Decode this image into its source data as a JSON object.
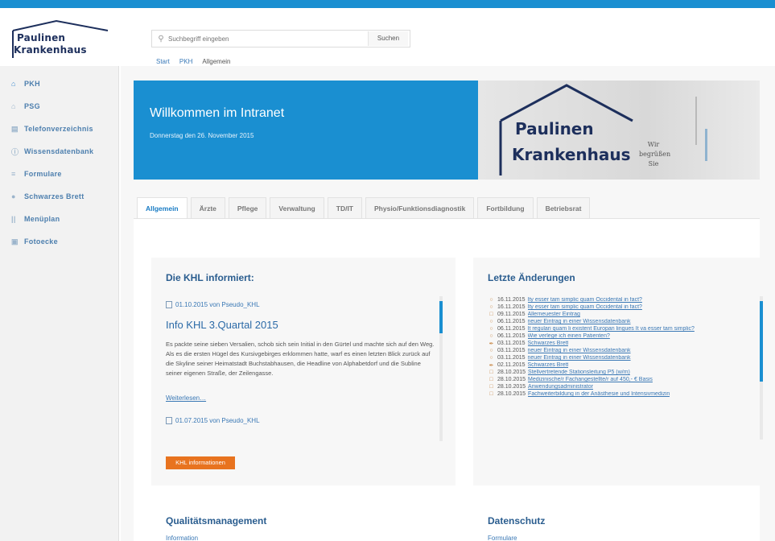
{
  "logo": {
    "line1": "Paulinen",
    "line2": "Krankenhaus"
  },
  "search": {
    "placeholder": "Suchbegriff eingeben",
    "button": "Suchen"
  },
  "breadcrumb": [
    "Start",
    "PKH",
    "Allgemein"
  ],
  "sidebar": {
    "items": [
      {
        "label": "PKH",
        "icon": "home-icon"
      },
      {
        "label": "PSG",
        "icon": "building-icon"
      },
      {
        "label": "Telefonverzeichnis",
        "icon": "phone-book-icon"
      },
      {
        "label": "Wissensdatenbank",
        "icon": "info-icon"
      },
      {
        "label": "Formulare",
        "icon": "list-icon"
      },
      {
        "label": "Schwarzes Brett",
        "icon": "pin-icon"
      },
      {
        "label": "Menüplan",
        "icon": "cutlery-icon"
      },
      {
        "label": "Fotoecke",
        "icon": "camera-icon"
      }
    ]
  },
  "banner": {
    "title": "Willkommen im Intranet",
    "date": "Donnerstag den 26. November 2015",
    "logo_line1": "Paulinen",
    "logo_line2": "Krankenhaus",
    "greeting": [
      "Wir",
      "begrüßen",
      "Sie"
    ]
  },
  "tabs": [
    "Allgemein",
    "Ärzte",
    "Pflege",
    "Verwaltung",
    "TD/IT",
    "Physio/Funktionsdiagnostik",
    "Fortbildung",
    "Betriebsrat"
  ],
  "info_card": {
    "title": "Die KHL informiert:",
    "post1_meta": "01.10.2015 von Pseudo_KHL",
    "post_title": "Info KHL 3.Quartal 2015",
    "post_body": "Es packte seine sieben Versalien, schob sich sein Initial in den Gürtel und machte sich auf den Weg. Als es die ersten Hügel des Kursivgebirges erklommen hatte, warf es einen letzten Blick zurück auf die Skyline seiner Heimatstadt Buchstabhausen, die Headline von Alphabetdorf und die Subline seiner eigenen Straße, der Zeilengasse.",
    "read_more": "Weiterlesen…",
    "post2_meta": "01.07.2015 von Pseudo_KHL",
    "button": "KHL informationen"
  },
  "changes_card": {
    "title": "Letzte Änderungen",
    "items": [
      {
        "date": "16.11.2015",
        "text": "Ity esser tam simplic quam Occidental in fact?"
      },
      {
        "date": "16.11.2015",
        "text": "Ity esser tam simplic quam Occidental in fact?"
      },
      {
        "date": "09.11.2015",
        "text": "Allerneuester Eintrag"
      },
      {
        "date": "06.11.2015",
        "text": "neuer Eintrag in einer Wissensdatenbank"
      },
      {
        "date": "06.11.2015",
        "text": "It regulari quam li existent Europan lingues It va esser tam simplic?"
      },
      {
        "date": "06.11.2015",
        "text": "Wie verlege ich einen Patienten?"
      },
      {
        "date": "03.11.2015",
        "text": "Schwarzes Brett"
      },
      {
        "date": "03.11.2015",
        "text": "neuer Eintrag in einer Wissensdatenbank"
      },
      {
        "date": "03.11.2015",
        "text": "neuer Eintrag in einer Wissensdatenbank"
      },
      {
        "date": "02.11.2015",
        "text": "Schwarzes Brett"
      },
      {
        "date": "28.10.2015",
        "text": "Stellvertretende Stationsleitung P5 (w/m)"
      },
      {
        "date": "28.10.2015",
        "text": "Medizinische/r Fachangestellte/r auf 450,- € Basis"
      },
      {
        "date": "28.10.2015",
        "text": "Anwendungsadministrator"
      },
      {
        "date": "28.10.2015",
        "text": "Fachweiterbildung in der Anästhesie und Intensivmedizin"
      }
    ]
  },
  "sections": [
    {
      "title": "Qualitätsmanagement",
      "sub": "Information"
    },
    {
      "title": "Datenschutz",
      "sub": "Formulare"
    }
  ]
}
